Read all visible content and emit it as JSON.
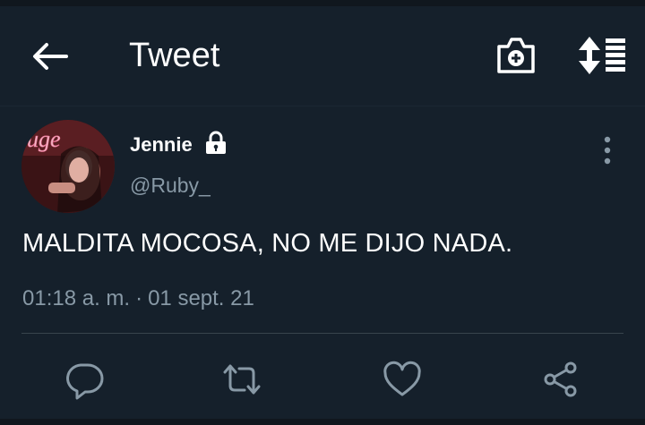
{
  "header": {
    "title": "Tweet",
    "back_icon": "arrow-left-icon",
    "camera_icon": "camera-plus-icon",
    "sort_icon": "sort-list-icon"
  },
  "tweet": {
    "author": {
      "display_name": "Jennie",
      "handle": "@Ruby_",
      "protected_icon": "lock-icon",
      "avatar_sign": "uge"
    },
    "text": "MALDITA MOCOSA, NO ME DIJO NADA.",
    "time": "01:18 a. m.",
    "separator": "·",
    "date": "01 sept. 21"
  },
  "actions": [
    {
      "name": "reply",
      "icon": "comment-icon"
    },
    {
      "name": "retweet",
      "icon": "retweet-icon"
    },
    {
      "name": "like",
      "icon": "heart-icon"
    },
    {
      "name": "share",
      "icon": "share-icon"
    }
  ],
  "colors": {
    "background": "#15202b",
    "text_primary": "#ffffff",
    "text_secondary": "#8899a6",
    "divider": "#38444d"
  }
}
